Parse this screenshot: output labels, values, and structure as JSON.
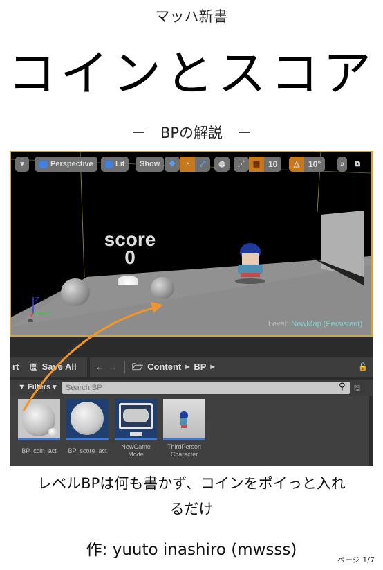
{
  "header": {
    "series": "マッハ新書",
    "title": "コインとスコア",
    "subtitle": "ー　BPの解説　ー"
  },
  "editor": {
    "viewport_toolbar": {
      "menu_icon": "dropdown-triangle-icon",
      "perspective": "Perspective",
      "lit": "Lit",
      "show": "Show",
      "grid_snap": "10",
      "angle_snap": "10°",
      "more": "»",
      "maximize_icon": "restore-window-icon"
    },
    "scene": {
      "score_label": "score",
      "score_value": "0",
      "level_prefix": "Level:",
      "level_name": "NewMap (Persistent)",
      "axis_z": "Z",
      "axis_y": "Y"
    },
    "content_browser": {
      "truncated_button": "rt",
      "save_all": "Save All",
      "back": "←",
      "forward": "→",
      "path": [
        "Content",
        "BP"
      ],
      "filters": "Filters",
      "search_placeholder": "Search BP",
      "assets": [
        {
          "label": "BP_coin_act",
          "kind": "sphere-with-small"
        },
        {
          "label": "BP_score_act",
          "kind": "sphere"
        },
        {
          "label": "NewGame Mode",
          "line1": "NewGame",
          "line2": "Mode",
          "kind": "gamepad"
        },
        {
          "label": "ThirdPerson Character",
          "line1": "ThirdPerson",
          "line2": "Character",
          "kind": "character"
        }
      ]
    },
    "colors": {
      "accent_orange": "#f0962a",
      "selection_blue": "#3d78d8",
      "level_name": "#7fcfd0",
      "viewport_border": "#c5a453"
    }
  },
  "caption": {
    "line1": "レベルBPは何も書かず、コインをポイっと入れ",
    "line2": "るだけ"
  },
  "author": "作: yuuto inashiro (mwsss)",
  "page_indicator": "ページ 1/7"
}
